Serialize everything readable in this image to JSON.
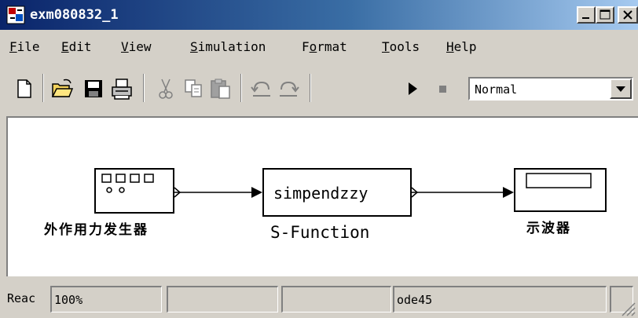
{
  "window": {
    "title": "exm080832_1",
    "colors": {
      "titlebar_start": "#0a246a",
      "titlebar_end": "#a6caf0",
      "chrome": "#d4d0c8"
    }
  },
  "menu": [
    {
      "underline": "F",
      "rest": "ile"
    },
    {
      "underline": "E",
      "rest": "dit"
    },
    {
      "underline": "V",
      "rest": "iew"
    },
    {
      "underline": "S",
      "rest": "imulation"
    },
    {
      "prefix": "F",
      "underline": "o",
      "rest": "rmat"
    },
    {
      "underline": "T",
      "rest": "ools"
    },
    {
      "underline": "H",
      "rest": "elp"
    }
  ],
  "toolbar": {
    "icons": [
      "new-file-icon",
      "open-folder-icon",
      "save-icon",
      "print-icon",
      "cut-icon",
      "copy-icon",
      "paste-icon",
      "undo-icon",
      "redo-icon",
      "start-simulation-icon",
      "stop-simulation-icon"
    ],
    "sim_mode": "Normal"
  },
  "diagram": {
    "blocks": [
      {
        "name": "signal-generator-block",
        "label": "外作用力发生器"
      },
      {
        "name": "s-function-block",
        "text": "simpendzzy",
        "label": "S-Function"
      },
      {
        "name": "scope-block",
        "label": "示波器"
      }
    ]
  },
  "status": {
    "ready": "Reac",
    "zoom": "100%",
    "cell3": "",
    "cell4": "",
    "solver": "ode45",
    "cell6": ""
  }
}
